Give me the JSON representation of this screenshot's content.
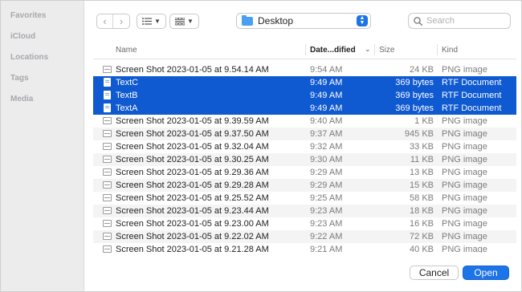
{
  "sidebar": {
    "items": [
      {
        "label": "Favorites"
      },
      {
        "label": "iCloud"
      },
      {
        "label": "Locations"
      },
      {
        "label": "Tags"
      },
      {
        "label": "Media"
      }
    ]
  },
  "toolbar": {
    "location": "Desktop",
    "search_placeholder": "Search"
  },
  "columns": {
    "name": "Name",
    "date": "Date...dified",
    "size": "Size",
    "kind": "Kind"
  },
  "files": [
    {
      "name": "Screen Shot 2023-01-05 at 9.54.14 AM",
      "date": "9:54 AM",
      "size": "24 KB",
      "kind": "PNG image",
      "selected": false,
      "icon": "image-file-icon"
    },
    {
      "name": "TextC",
      "date": "9:49 AM",
      "size": "369 bytes",
      "kind": "RTF Document",
      "selected": true,
      "icon": "document-file-icon"
    },
    {
      "name": "TextB",
      "date": "9:49 AM",
      "size": "369 bytes",
      "kind": "RTF Document",
      "selected": true,
      "icon": "document-file-icon"
    },
    {
      "name": "TextA",
      "date": "9:49 AM",
      "size": "369 bytes",
      "kind": "RTF Document",
      "selected": true,
      "icon": "document-file-icon"
    },
    {
      "name": "Screen Shot 2023-01-05 at 9.39.59 AM",
      "date": "9:40 AM",
      "size": "1 KB",
      "kind": "PNG image",
      "selected": false,
      "icon": "image-file-icon"
    },
    {
      "name": "Screen Shot 2023-01-05 at 9.37.50 AM",
      "date": "9:37 AM",
      "size": "945 KB",
      "kind": "PNG image",
      "selected": false,
      "icon": "image-file-icon"
    },
    {
      "name": "Screen Shot 2023-01-05 at 9.32.04 AM",
      "date": "9:32 AM",
      "size": "33 KB",
      "kind": "PNG image",
      "selected": false,
      "icon": "image-file-icon"
    },
    {
      "name": "Screen Shot 2023-01-05 at 9.30.25 AM",
      "date": "9:30 AM",
      "size": "11 KB",
      "kind": "PNG image",
      "selected": false,
      "icon": "image-file-icon"
    },
    {
      "name": "Screen Shot 2023-01-05 at 9.29.36 AM",
      "date": "9:29 AM",
      "size": "13 KB",
      "kind": "PNG image",
      "selected": false,
      "icon": "image-file-icon"
    },
    {
      "name": "Screen Shot 2023-01-05 at 9.29.28 AM",
      "date": "9:29 AM",
      "size": "15 KB",
      "kind": "PNG image",
      "selected": false,
      "icon": "image-file-icon"
    },
    {
      "name": "Screen Shot 2023-01-05 at 9.25.52 AM",
      "date": "9:25 AM",
      "size": "58 KB",
      "kind": "PNG image",
      "selected": false,
      "icon": "image-file-icon"
    },
    {
      "name": "Screen Shot 2023-01-05 at 9.23.44 AM",
      "date": "9:23 AM",
      "size": "18 KB",
      "kind": "PNG image",
      "selected": false,
      "icon": "image-file-icon"
    },
    {
      "name": "Screen Shot 2023-01-05 at 9.23.00 AM",
      "date": "9:23 AM",
      "size": "16 KB",
      "kind": "PNG image",
      "selected": false,
      "icon": "image-file-icon"
    },
    {
      "name": "Screen Shot 2023-01-05 at 9.22.02 AM",
      "date": "9:22 AM",
      "size": "72 KB",
      "kind": "PNG image",
      "selected": false,
      "icon": "image-file-icon"
    },
    {
      "name": "Screen Shot 2023-01-05 at 9.21.28 AM",
      "date": "9:21 AM",
      "size": "40 KB",
      "kind": "PNG image",
      "selected": false,
      "icon": "image-file-icon"
    }
  ],
  "footer": {
    "cancel_label": "Cancel",
    "open_label": "Open"
  },
  "colors": {
    "selection": "#0f59d1",
    "accent": "#1d74e8"
  }
}
